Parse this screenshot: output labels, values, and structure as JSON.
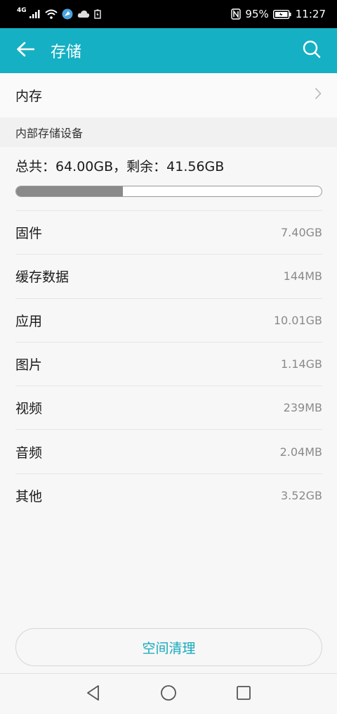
{
  "status_bar": {
    "network_type": "4G",
    "battery_percent": "95%",
    "time": "11:27"
  },
  "app_bar": {
    "title": "存储",
    "back_icon": "arrow-left-icon",
    "search_icon": "search-icon",
    "color": "#15b0c4"
  },
  "memory_row": {
    "label": "内存"
  },
  "section": {
    "header": "内部存储设备",
    "summary": "总共：64.00GB，剩余：41.56GB",
    "used_fraction": 0.35
  },
  "items": [
    {
      "label": "固件",
      "value": "7.40GB"
    },
    {
      "label": "缓存数据",
      "value": "144MB"
    },
    {
      "label": "应用",
      "value": "10.01GB"
    },
    {
      "label": "图片",
      "value": "1.14GB"
    },
    {
      "label": "视频",
      "value": "239MB"
    },
    {
      "label": "音频",
      "value": "2.04MB"
    },
    {
      "label": "其他",
      "value": "3.52GB"
    }
  ],
  "clean_button": {
    "label": "空间清理"
  },
  "nav_bar": {
    "icons": [
      "back-triangle-icon",
      "home-circle-icon",
      "recents-square-icon"
    ]
  }
}
